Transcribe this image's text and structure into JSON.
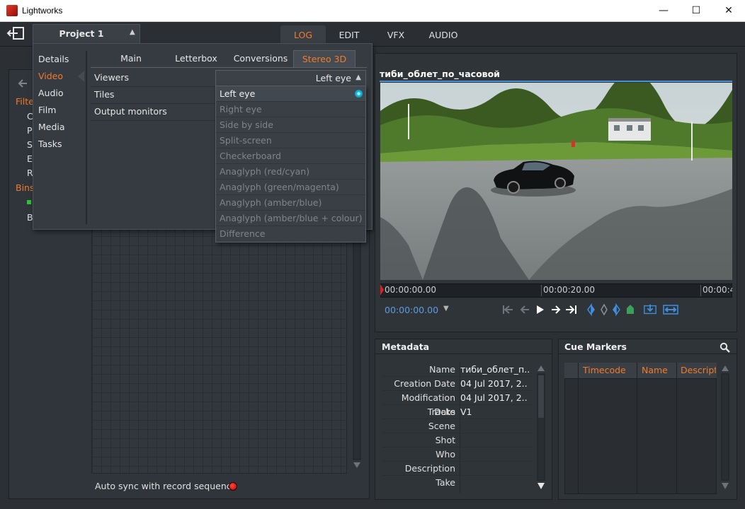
{
  "window": {
    "title": "Lightworks",
    "minimize": "—",
    "maximize": "☐",
    "close": "✕"
  },
  "main_tabs": [
    "LOG",
    "EDIT",
    "VFX",
    "AUDIO"
  ],
  "project": {
    "title": "Project 1",
    "categories": [
      "Details",
      "Video",
      "Audio",
      "Film",
      "Media",
      "Tasks"
    ],
    "selected_category": "Video",
    "subtabs": [
      "Main",
      "Letterbox",
      "Conversions",
      "Stereo 3D"
    ],
    "selected_subtab": "Stereo 3D",
    "rows": [
      "Viewers",
      "Tiles",
      "Output monitors"
    ],
    "viewers_value": "Left eye",
    "viewer_options": [
      "Left eye",
      "Right eye",
      "Side by side",
      "Split-screen",
      "Checkerboard",
      "Anaglyph (red/cyan)",
      "Anaglyph (green/magenta)",
      "Anaglyph (amber/blue)",
      "Anaglyph (amber/blue + colour)",
      "Difference"
    ]
  },
  "left_panel": {
    "peek_filter": "Filte",
    "peek_bins": "Bins",
    "peek_letters": [
      "C",
      "P",
      "S",
      "E",
      "R"
    ],
    "peek_b": "B",
    "autosync_label": "Auto sync with record sequence"
  },
  "viewer": {
    "clip_title": "тиби_облет_по_часовой",
    "timecodes": [
      "00:00:00.00",
      "00:00:20.00",
      "00:00:4"
    ],
    "current_timecode": "00:00:00.00"
  },
  "metadata": {
    "title": "Metadata",
    "rows": [
      {
        "key": "Name",
        "value": "тиби_облет_п.."
      },
      {
        "key": "Creation Date",
        "value": "04 Jul 2017, 2.."
      },
      {
        "key": "Modification Date",
        "value": "04 Jul 2017, 2.."
      },
      {
        "key": "Tracks",
        "value": "V1"
      },
      {
        "key": "Scene",
        "value": ""
      },
      {
        "key": "Shot",
        "value": ""
      },
      {
        "key": "Who",
        "value": ""
      },
      {
        "key": "Description",
        "value": ""
      },
      {
        "key": "Take",
        "value": ""
      }
    ]
  },
  "cue_markers": {
    "title": "Cue Markers",
    "columns": [
      "Timecode",
      "Name",
      "Descripti"
    ]
  },
  "colors": {
    "accent_orange": "#f07b2a",
    "accent_blue": "#4a91d6",
    "record_red": "#e02020",
    "selected_cyan": "#14c6e6"
  }
}
